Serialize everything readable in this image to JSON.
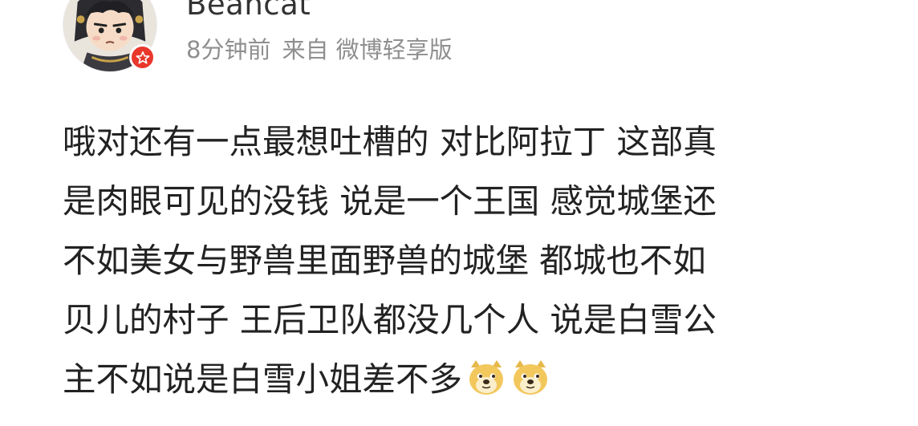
{
  "header": {
    "username": "Beancat",
    "time": "8分钟前",
    "source": "来自 微博轻享版"
  },
  "post": {
    "lines": [
      "哦对还有一点最想吐槽的 对比阿拉丁 这部真",
      "是肉眼可见的没钱 说是一个王国 感觉城堡还",
      "不如美女与野兽里面野兽的城堡 都城也不如",
      "贝儿的村子 王后卫队都没几个人 说是白雪公",
      "主不如说是白雪小姐差不多"
    ],
    "emojis": [
      "doge-emoji",
      "doge-emoji"
    ]
  },
  "colors": {
    "username": "#333333",
    "meta": "#8f8f8f",
    "text": "#222222",
    "badge": "#e9372b",
    "emoji": "#f2c75c"
  }
}
